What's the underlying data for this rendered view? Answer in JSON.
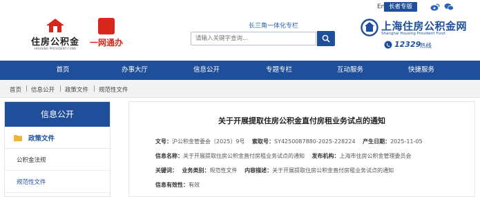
{
  "header": {
    "logo_left": {
      "name": "住房公积金",
      "sub": "HOUSING PROVIDENT FUND"
    },
    "logo_mid": {
      "name": "一网通办"
    },
    "tagline": "长三角一体化专栏",
    "search": {
      "placeholder": "请输入关键字查询..."
    },
    "lang": "En",
    "elder_mode": "长者专版",
    "brand": {
      "cn": "上海住房公积金网",
      "en": "Shanghai Housing Provident Fund",
      "phone": "12329",
      "phone_label": "热线"
    }
  },
  "nav": {
    "items": [
      "首页",
      "办事大厅",
      "信息公开",
      "专题专栏",
      "互动服务",
      "快捷服务"
    ]
  },
  "breadcrumb": [
    "首页",
    "信息公开",
    "政策文件",
    "规范性文件"
  ],
  "sidebar": {
    "title": "信息公开",
    "active": "政策文件",
    "items": [
      "公积金法规",
      "规范性文件"
    ]
  },
  "doc": {
    "title": "关于开展提取住房公积金直付房租业务试点的通知",
    "doc_no_label": "文号：",
    "doc_no": "沪公积金管委会〔2025〕9号",
    "index_label": "索取号：",
    "index": "SY4250087880-2025-228224",
    "date_label": "产生日期：",
    "date": "2025-11-05",
    "info_name_label": "信息名称：",
    "info_name": "关于开展提取住房公积金直付房租业务试点的通知",
    "publisher_label": "发布机构：",
    "publisher": "上海市住房公积金管理委员会",
    "keywords_label": "关键词：",
    "business_label": "业务类别：",
    "business": "规范性文件",
    "desc_label": "内容描述：",
    "desc": "关于开展提取住房公积金直付房租业务试点的通知",
    "validity_label": "信息有效性：",
    "validity": "有效"
  },
  "colors": {
    "primary": "#1f4f9b",
    "accent_red": "#d9261c"
  },
  "icons": [
    "search-icon",
    "weibo-icon",
    "wechat-icon",
    "phone-icon",
    "folder-icon"
  ]
}
